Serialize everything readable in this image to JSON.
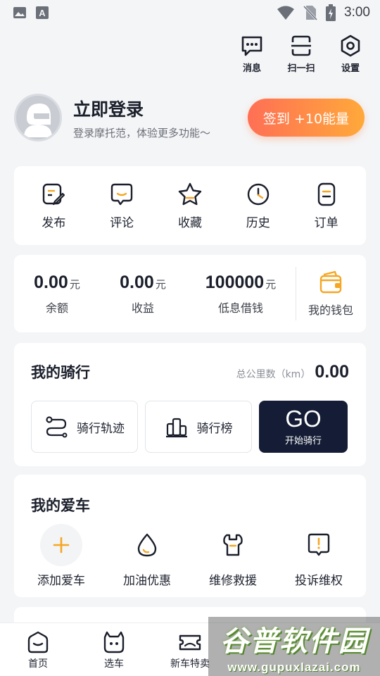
{
  "status_bar": {
    "time": "3:00"
  },
  "top_actions": [
    {
      "label": "消息",
      "icon": "message-icon"
    },
    {
      "label": "扫一扫",
      "icon": "scan-icon"
    },
    {
      "label": "设置",
      "icon": "settings-icon"
    }
  ],
  "profile": {
    "title": "立即登录",
    "subtitle": "登录摩托范，体验更多功能～",
    "checkin_label": "签到 +10能量"
  },
  "quick_menu": [
    {
      "label": "发布",
      "icon": "edit-icon"
    },
    {
      "label": "评论",
      "icon": "comment-icon"
    },
    {
      "label": "收藏",
      "icon": "star-icon"
    },
    {
      "label": "历史",
      "icon": "clock-icon"
    },
    {
      "label": "订单",
      "icon": "order-icon"
    }
  ],
  "wallet": {
    "stats": [
      {
        "value": "0.00",
        "unit": "元",
        "label": "余额"
      },
      {
        "value": "0.00",
        "unit": "元",
        "label": "收益"
      },
      {
        "value": "100000",
        "unit": "元",
        "label": "低息借钱"
      }
    ],
    "purse_label": "我的钱包"
  },
  "riding": {
    "title": "我的骑行",
    "km_label": "总公里数（km）",
    "km_value": "0.00",
    "track_label": "骑行轨迹",
    "rank_label": "骑行榜",
    "go_label": "GO",
    "go_sub": "开始骑行"
  },
  "my_car": {
    "title": "我的爱车",
    "items": [
      {
        "label": "添加爱车",
        "icon": "plus-icon"
      },
      {
        "label": "加油优惠",
        "icon": "fuel-drop-icon"
      },
      {
        "label": "维修救援",
        "icon": "wrench-icon"
      },
      {
        "label": "投诉维权",
        "icon": "complaint-icon"
      }
    ]
  },
  "tabbar": [
    {
      "label": "首页",
      "icon": "home-icon"
    },
    {
      "label": "选车",
      "icon": "select-car-icon"
    },
    {
      "label": "新车特卖",
      "icon": "sale-icon"
    }
  ],
  "watermark": {
    "text": "谷普软件园",
    "url": "www.gupuxlazai.com"
  },
  "colors": {
    "accent_orange": "#ffa93a",
    "accent_red": "#ff6f55",
    "dark_navy": "#141d35"
  }
}
